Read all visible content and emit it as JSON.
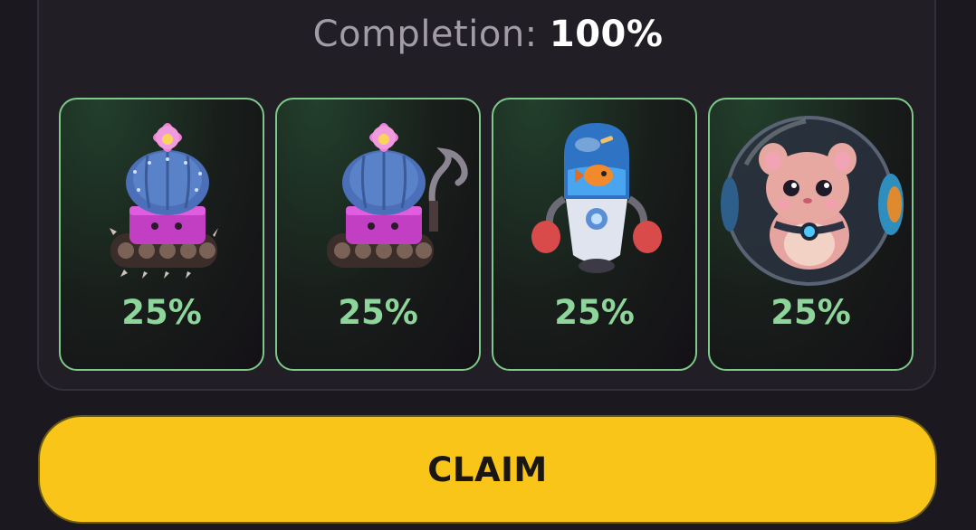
{
  "completion": {
    "label": "Completion:",
    "value": "100%"
  },
  "cards": [
    {
      "icon": "cactus-tank-icon",
      "percent": "25%"
    },
    {
      "icon": "cactus-tank-smoke-icon",
      "percent": "25%"
    },
    {
      "icon": "fish-robot-boxer-icon",
      "percent": "25%"
    },
    {
      "icon": "hamster-ball-icon",
      "percent": "25%"
    }
  ],
  "claim": {
    "label": "CLAIM"
  },
  "colors": {
    "background": "#1c181f",
    "card_border": "#7ec98a",
    "percent_text": "#8dd59a",
    "claim_button": "#f9c518"
  }
}
